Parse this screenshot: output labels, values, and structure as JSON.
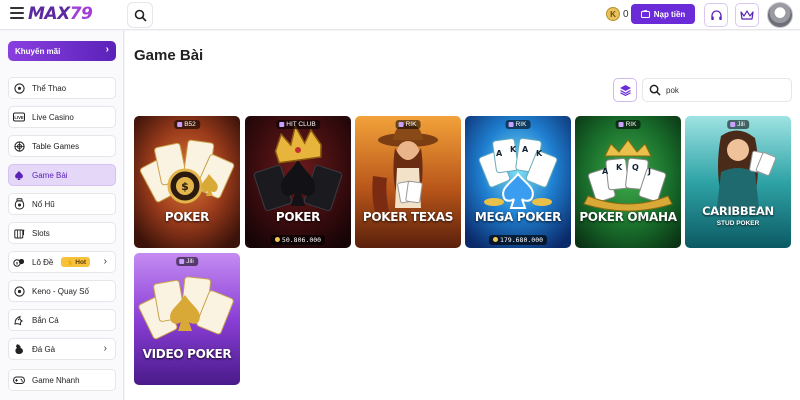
{
  "header": {
    "logo_text": "MAX",
    "logo_number": "79",
    "balance_currency": "K",
    "balance": "0",
    "deposit_label": "Nạp tiền"
  },
  "sidebar": {
    "promo_label": "Khuyến mãi",
    "items": [
      {
        "label": "Thể Thao",
        "icon": "soccer-ball-icon"
      },
      {
        "label": "Live Casino",
        "icon": "live-icon"
      },
      {
        "label": "Table Games",
        "icon": "roulette-icon"
      },
      {
        "label": "Game Bài",
        "icon": "card-spade-icon",
        "active": true
      },
      {
        "label": "Nổ Hũ",
        "icon": "jar-icon"
      },
      {
        "label": "Slots",
        "icon": "slot-icon"
      },
      {
        "label": "Lô Đề",
        "icon": "lottery-icon",
        "badge": "Hot",
        "chevron": true
      },
      {
        "label": "Keno - Quay Số",
        "icon": "keno-icon"
      },
      {
        "label": "Bắn Cá",
        "icon": "fish-icon"
      },
      {
        "label": "Đá Gà",
        "icon": "rooster-icon",
        "chevron": true
      },
      {
        "label": "Game Nhanh",
        "icon": "gamepad-icon"
      }
    ]
  },
  "main": {
    "title": "Game Bài",
    "search_value": "pok",
    "games": [
      {
        "name": "POKER",
        "provider": "B52",
        "jackpot": ""
      },
      {
        "name": "POKER",
        "provider": "HIT CLUB",
        "jackpot": "50.806.000"
      },
      {
        "name": "POKER TEXAS",
        "provider": "RIK",
        "jackpot": ""
      },
      {
        "name": "MEGA POKER",
        "provider": "RIK",
        "jackpot": "179.680.000"
      },
      {
        "name": "POKER OMAHA",
        "provider": "RIK",
        "jackpot": ""
      },
      {
        "name": "CARIBBEAN",
        "subtitle": "STUD POKER",
        "provider": "Jili",
        "jackpot": ""
      },
      {
        "name": "VIDEO POKER",
        "provider": "Jili",
        "jackpot": ""
      }
    ]
  },
  "colors": {
    "accent": "#6c2bd9",
    "active_bg": "#e4d7f7",
    "hot_badge": "#f7c23b"
  }
}
